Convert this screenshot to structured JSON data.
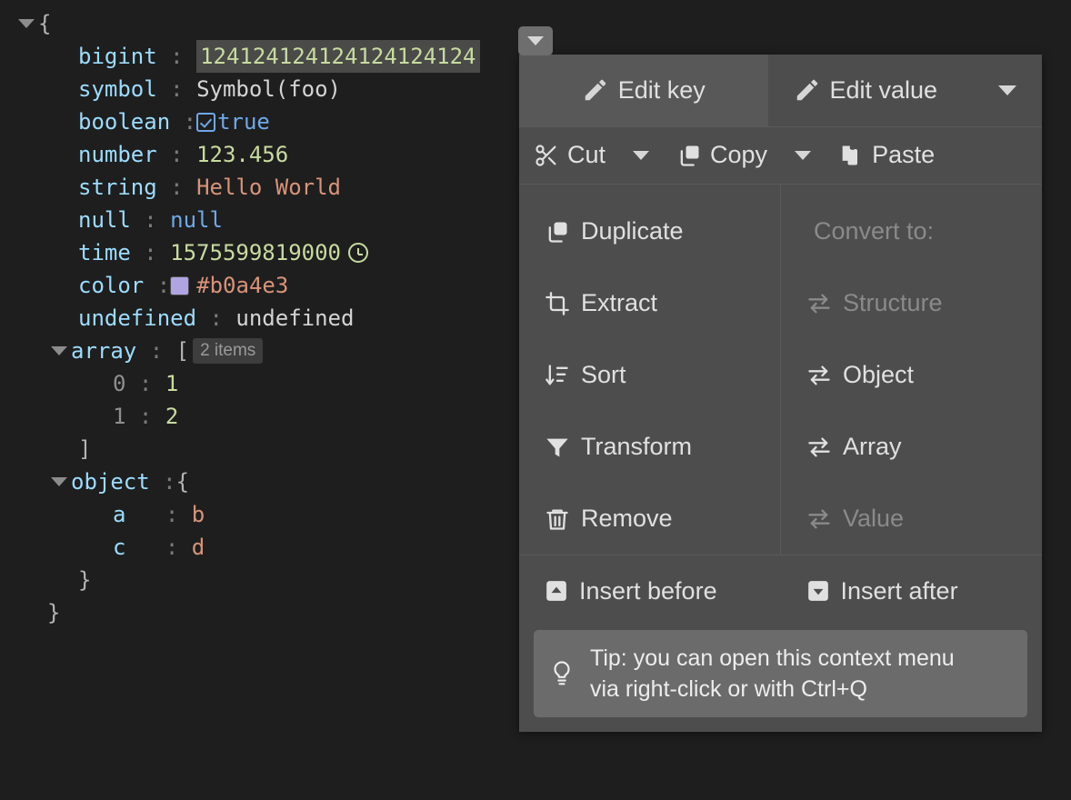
{
  "editor": {
    "root_open_brace": "{",
    "root_close_brace": "}",
    "rows": [
      {
        "key": "bigint",
        "sep": ":",
        "value": "124124124124124124124",
        "type": "number",
        "highlighted": true
      },
      {
        "key": "symbol",
        "sep": ":",
        "value": "Symbol(foo)",
        "type": "plain"
      },
      {
        "key": "boolean",
        "sep": ":",
        "value": "true",
        "type": "boolean",
        "icon": "checkbox-checked-icon"
      },
      {
        "key": "number",
        "sep": ":",
        "value": "123.456",
        "type": "number"
      },
      {
        "key": "string",
        "sep": ":",
        "value": "Hello World",
        "type": "string"
      },
      {
        "key": "null",
        "sep": ":",
        "value": "null",
        "type": "null"
      },
      {
        "key": "time",
        "sep": ":",
        "value": "1575599819000",
        "type": "number",
        "icon": "clock-icon"
      },
      {
        "key": "color",
        "sep": ":",
        "value": "#b0a4e3",
        "type": "string",
        "icon": "color-swatch",
        "swatch": "#b0a4e3"
      },
      {
        "key": "undefined",
        "sep": ":",
        "value": "undefined",
        "type": "plain"
      }
    ],
    "array": {
      "key": "array",
      "sep": ":",
      "open_bracket": "[",
      "close_bracket": "]",
      "badge": "2 items",
      "items": [
        {
          "index": "0",
          "sep": ":",
          "value": "1"
        },
        {
          "index": "1",
          "sep": ":",
          "value": "2"
        }
      ]
    },
    "object": {
      "key": "object",
      "sep": ":",
      "open_brace": "{",
      "close_brace": "}",
      "entries": [
        {
          "key": "a",
          "sep": ":",
          "value": "b"
        },
        {
          "key": "c",
          "sep": ":",
          "value": "d"
        }
      ]
    },
    "colors": {
      "background": "#1e1e1e",
      "key": "#9cdcfe",
      "number": "#c8dba0",
      "string": "#d8937a",
      "boolean": "#6fa8e8",
      "null": "#6fa8e8",
      "plain": "#d4d4d4",
      "separator": "#7a7a7a",
      "brace": "#b4b4b4",
      "selection": "#4a4a48"
    }
  },
  "toggle_button": {
    "name": "open-context-menu-button",
    "icon": "chevron-down-icon"
  },
  "context_menu": {
    "edit_key": {
      "label": "Edit key",
      "icon": "pencil-icon"
    },
    "edit_value": {
      "label": "Edit value",
      "icon": "pencil-icon",
      "caret": "chevron-down-icon"
    },
    "clipboard": {
      "cut": {
        "label": "Cut",
        "icon": "scissors-icon"
      },
      "copy": {
        "label": "Copy",
        "icon": "copy-icon"
      },
      "paste": {
        "label": "Paste",
        "icon": "paste-icon"
      }
    },
    "actions": [
      {
        "label": "Duplicate",
        "icon": "duplicate-icon",
        "disabled": false
      },
      {
        "label": "Extract",
        "icon": "extract-icon",
        "disabled": false
      },
      {
        "label": "Sort",
        "icon": "sort-icon",
        "disabled": false
      },
      {
        "label": "Transform",
        "icon": "filter-icon",
        "disabled": false
      },
      {
        "label": "Remove",
        "icon": "trash-icon",
        "disabled": false
      }
    ],
    "convert": {
      "header": "Convert to:",
      "options": [
        {
          "label": "Structure",
          "icon": "swap-icon",
          "disabled": true
        },
        {
          "label": "Object",
          "icon": "swap-icon",
          "disabled": false
        },
        {
          "label": "Array",
          "icon": "swap-icon",
          "disabled": false
        },
        {
          "label": "Value",
          "icon": "swap-icon",
          "disabled": true
        }
      ]
    },
    "insert_before": {
      "label": "Insert before",
      "icon": "insert-before-icon"
    },
    "insert_after": {
      "label": "Insert after",
      "icon": "insert-after-icon"
    },
    "tip": {
      "icon": "lightbulb-icon",
      "line1": "Tip: you can open this context menu",
      "line2": "via right-click or with Ctrl+Q"
    }
  }
}
